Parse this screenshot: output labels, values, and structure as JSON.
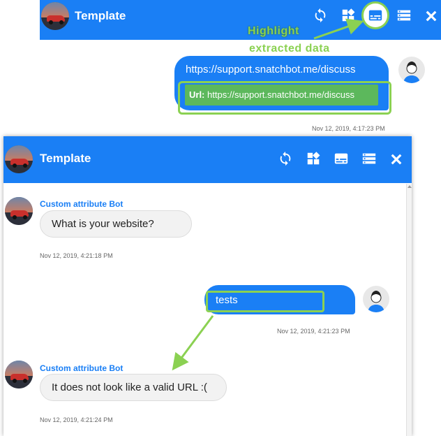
{
  "top_panel": {
    "header_title": "Template",
    "annotation_line1": "Highlight",
    "annotation_line2": "extracted data",
    "user_message": "https://support.snatchbot.me/discuss",
    "extracted_label": "Url:",
    "extracted_value": "https://support.snatchbot.me/discuss",
    "timestamp": "Nov 12, 2019, 4:17:23 PM"
  },
  "bottom_panel": {
    "header_title": "Template",
    "bot_name_1": "Custom attribute Bot",
    "bot_message_1": "What is your website?",
    "timestamp_1": "Nov 12, 2019, 4:21:18 PM",
    "user_message": "tests",
    "timestamp_2": "Nov 12, 2019, 4:21:23 PM",
    "bot_name_2": "Custom attribute Bot",
    "bot_message_2": "It does not look like a valid URL :(",
    "timestamp_3": "Nov 12, 2019, 4:21:24 PM"
  },
  "colors": {
    "header_blue": "#1a7ff5",
    "highlight_green": "#8bd152",
    "extracted_bg": "#5cb85c"
  },
  "icons": [
    "refresh-icon",
    "widgets-icon",
    "subtitles-icon",
    "storage-icon",
    "close-icon"
  ]
}
